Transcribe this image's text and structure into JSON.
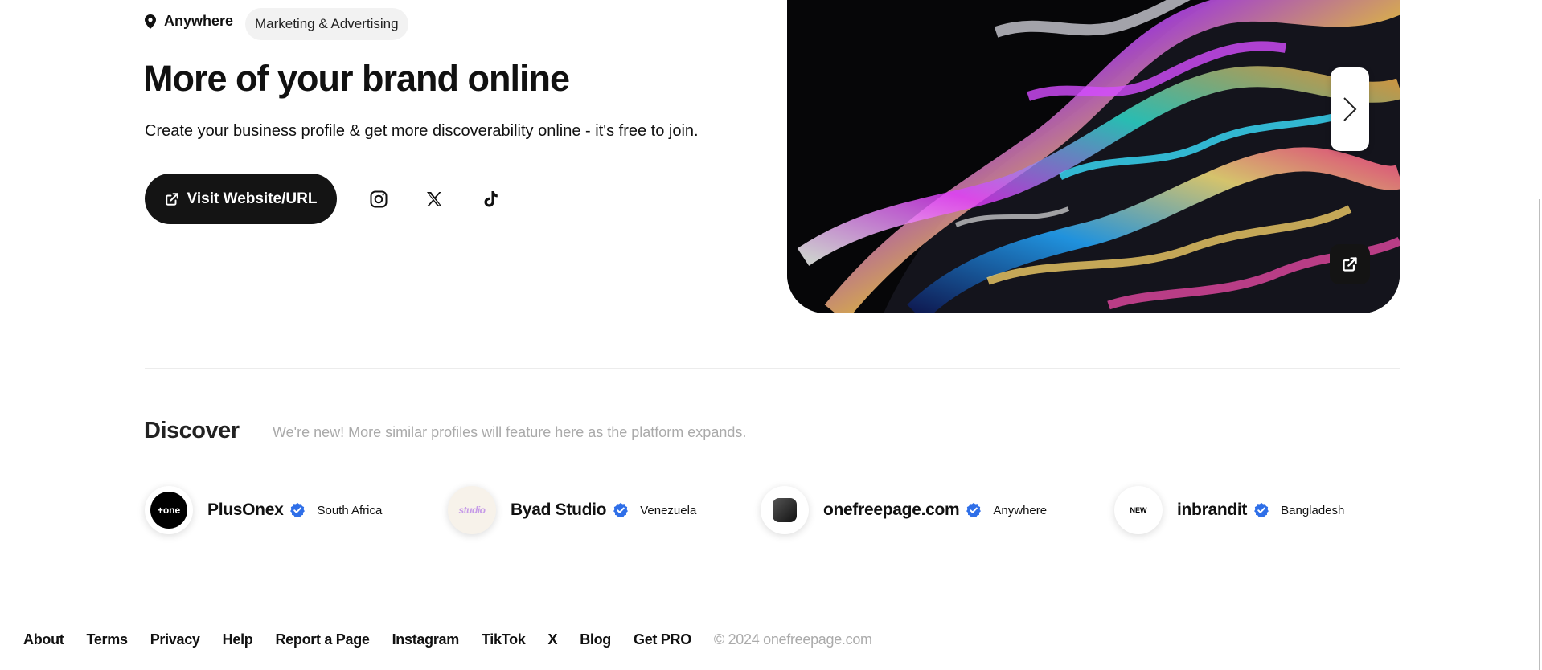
{
  "profile": {
    "location": "Anywhere",
    "category": "Marketing & Advertising",
    "title": "More of your brand online",
    "description": "Create your business profile & get more discoverability online - it's free to join.",
    "visit_label": "Visit Website/URL",
    "social_icons": [
      "instagram-icon",
      "x-icon",
      "tiktok-icon"
    ]
  },
  "discover": {
    "title": "Discover",
    "subtitle": "We're new! More similar profiles will feature here as the platform expands.",
    "profiles": [
      {
        "name": "PlusOnex",
        "location": "South Africa",
        "logo_text": "+one"
      },
      {
        "name": "Byad Studio",
        "location": "Venezuela",
        "logo_text": "studio"
      },
      {
        "name": "onefreepage.com",
        "location": "Anywhere",
        "logo_text": ""
      },
      {
        "name": "inbrandit",
        "location": "Bangladesh",
        "logo_text": "NEW"
      }
    ]
  },
  "footer": {
    "links": [
      "About",
      "Terms",
      "Privacy",
      "Help",
      "Report a Page",
      "Instagram",
      "TikTok",
      "X",
      "Blog",
      "Get PRO"
    ],
    "copyright": "© 2024 onefreepage.com"
  },
  "colors": {
    "dark": "#141414",
    "verified": "#2f6fe8",
    "muted": "#aaaaaa"
  }
}
